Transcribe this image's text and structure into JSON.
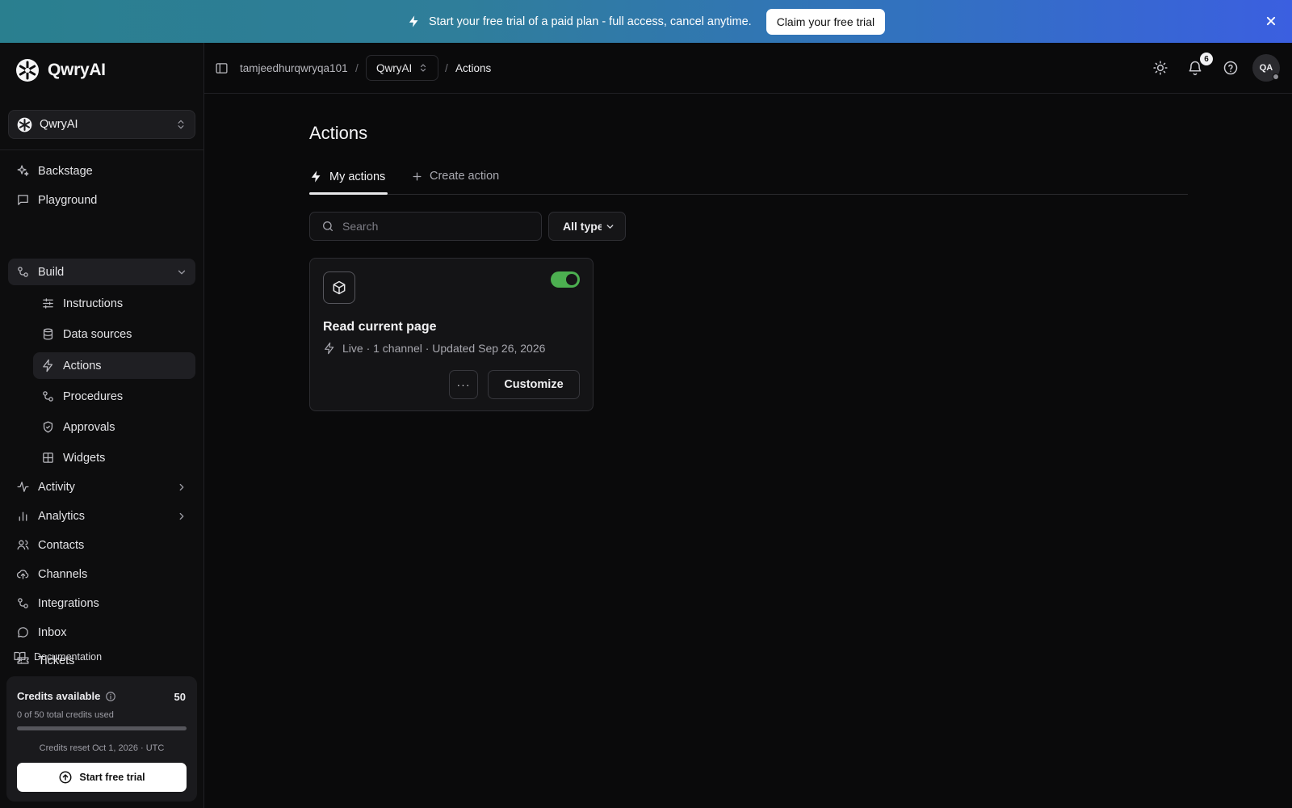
{
  "banner": {
    "text": "Start your free trial of a paid plan - full access, cancel anytime.",
    "cta": "Claim your free trial"
  },
  "brand": {
    "name": "QwryAI"
  },
  "workspace": {
    "name": "QwryAI"
  },
  "nav": {
    "backstage": "Backstage",
    "playground": "Playground",
    "build": "Build",
    "instructions": "Instructions",
    "data_sources": "Data sources",
    "actions": "Actions",
    "procedures": "Procedures",
    "approvals": "Approvals",
    "widgets": "Widgets",
    "activity": "Activity",
    "analytics": "Analytics",
    "contacts": "Contacts",
    "channels": "Channels",
    "integrations": "Integrations",
    "inbox": "Inbox",
    "tickets": "Tickets",
    "documentation": "Documentation"
  },
  "credits": {
    "title": "Credits available",
    "available": "50",
    "used_text": "0 of 50 total credits used",
    "used_fraction": 0.0,
    "reset_text": "Credits reset Oct 1, 2026 · UTC",
    "cta": "Start free trial"
  },
  "breadcrumb": {
    "user": "tamjeedhurqwryqa101",
    "sep": "/",
    "project": "QwryAI",
    "current": "Actions"
  },
  "topbar": {
    "notifications": "6",
    "avatar": "QA"
  },
  "page": {
    "title": "Actions",
    "tabs": {
      "my_actions": "My actions",
      "create_action": "Create action"
    },
    "search_placeholder": "Search",
    "type_filter": "All types"
  },
  "actions": [
    {
      "title": "Read current page",
      "meta": "Live · 1 channel · Updated Sep 26, 2026",
      "enabled": true,
      "customize": "Customize",
      "more": "···"
    }
  ],
  "colors": {
    "toggle_on": "#4caf50",
    "banner_start": "#2a7f8f",
    "banner_end": "#3b5fe0"
  }
}
